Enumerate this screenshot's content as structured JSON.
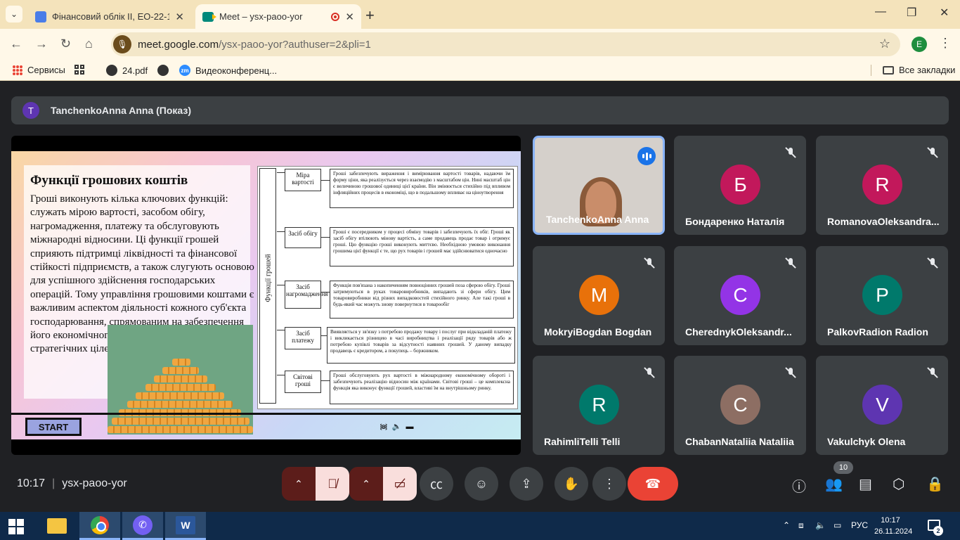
{
  "browser": {
    "tabs": [
      {
        "title": "Фінансовий облік ІІ, ЕО-22-1."
      },
      {
        "title": "Meet – ysx-paoo-yor"
      }
    ],
    "url_host": "meet.google.com",
    "url_rest": "/ysx-paoo-yor?authuser=2&pli=1",
    "profile_initial": "E",
    "bookmarks": [
      "Сервисы",
      "24.pdf",
      "Видеоконференц..."
    ],
    "all_bookmarks": "Все закладки"
  },
  "meet": {
    "presenter_initial": "T",
    "presenter_label": "TanchenkoAnna Anna (Показ)",
    "time": "10:17",
    "meeting_code": "ysx-paoo-yor",
    "people_count": "10",
    "participants": [
      {
        "name": "TanchenkoAnna Anna",
        "initial": "",
        "color": "",
        "video": true
      },
      {
        "name": "Бондаренко Наталія",
        "initial": "Б",
        "color": "#c2185b"
      },
      {
        "name": "RomanovaOleksandra...",
        "initial": "R",
        "color": "#c2185b"
      },
      {
        "name": "MokryiBogdan Bogdan",
        "initial": "M",
        "color": "#e8710a"
      },
      {
        "name": "CherednykOleksandr...",
        "initial": "C",
        "color": "#9334e6"
      },
      {
        "name": "PalkovRadion Radion",
        "initial": "P",
        "color": "#00796b"
      },
      {
        "name": "RahimliTelli Telli",
        "initial": "R",
        "color": "#00796b"
      },
      {
        "name": "ChabanNataliia Nataliia",
        "initial": "C",
        "color": "#8d6e63"
      },
      {
        "name": "Vakulchyk Olena",
        "initial": "V",
        "color": "#5e35b1"
      }
    ]
  },
  "slide": {
    "title": "Функції грошових коштів",
    "body": "Гроші виконують кілька ключових функцій: служать мірою вартості, засобом обігу, нагромадження, платежу та обслуговують міжнародні відносини. Ці функції грошей сприяють підтримці ліквідності та фінансової стійкості підприємств, а також слугують основою для успішного здійснення господарських операцій. Тому управління грошовими коштами є важливим аспектом діяльності кожного суб'єкта господарювання, спрямованим на забезпечення його економічного розвитку та досягнення стратегічних цілей.",
    "start_label": "START",
    "diagram_label": "Функції грошей",
    "functions": [
      {
        "name": "Міра вартості",
        "desc": "Гроші забезпечують вираження і вимірювання вартості товарів, надаючи їм форму ціни, яка реалізується через взаємодію з масштабом цін. Нині масштаб цін є величиною грошової одиниці цієї країни. Він змінюється стихійно під впливом інфляційних процесів в економіці, що в подальшому впливає на ціноутворення"
      },
      {
        "name": "Засіб обігу",
        "desc": "Гроші є посередником у процесі обміну товарів і забезпечують їх обіг. Гроші як засіб обігу втілюють мінову вартість, а саме продавець продає товар і отримує гроші. Цю функцію гроші виконують миттєво. Необхідною умовою виконання грошима цієї функції є те, що рух товарів і грошей має здійснюватися одночасно"
      },
      {
        "name": "Засіб нагромадження",
        "desc": "Функція пов'язана з накопиченням повноцінних грошей поза сферою обігу. Гроші затримуються в руках товаровиробників, випадають зі сфери обігу. Цим товаровиробники від різних випадковостей стихійного ринку. Але такі гроші в будь-який час можуть знову повернутися в товарообіг"
      },
      {
        "name": "Засіб платежу",
        "desc": "Виявляється у зв'язку з потребою продажу товару і послуг при відкладаній платежу і викликається різницею в часі виробництва і реалізації ряду товарів або ж потребою купівлі товарів за відсутності наявних грошей. У даному випадку продавець є кредитором, а покупець – боржником."
      },
      {
        "name": "Світові гроші",
        "desc": "Гроші обслуговують рух вартості в міжнародному економічному обороті і забезпечують реалізацію відносин між країнами. Світові гроші – це комплексна функція яка виконує функції грошей, властиві їм на внутрішньому ринку."
      }
    ]
  },
  "taskbar": {
    "lang": "РУС",
    "time": "10:17",
    "date": "26.11.2024",
    "notifications": "2"
  }
}
